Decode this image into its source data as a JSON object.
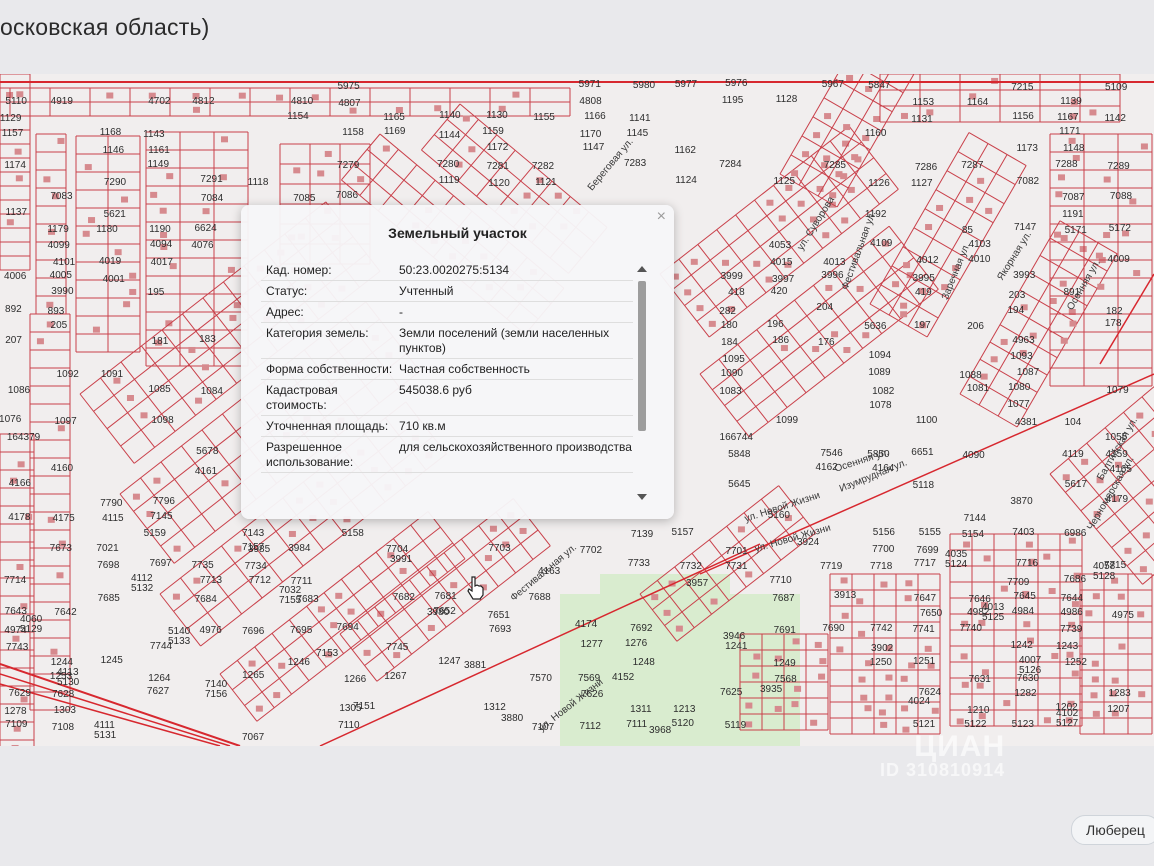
{
  "page": {
    "title": "осковская область)"
  },
  "map": {
    "parcel_labels": [
      "5975",
      "5971",
      "5980",
      "5977",
      "5976",
      "5967",
      "5847",
      "7215",
      "5109",
      "5110",
      "4919",
      "4702",
      "4812",
      "4810",
      "4807",
      "4808",
      "1195",
      "1128",
      "1153",
      "1164",
      "1139",
      "1129",
      "1154",
      "1165",
      "1140",
      "1130",
      "1155",
      "1166",
      "1141",
      "1131",
      "1156",
      "1167",
      "1142",
      "1157",
      "1168",
      "1143",
      "1158",
      "1169",
      "1144",
      "1159",
      "1170",
      "1145",
      "1160",
      "1171",
      "1146",
      "1161",
      "1172",
      "1147",
      "1162",
      "1173",
      "1148",
      "1174",
      "1149",
      "7279",
      "7280",
      "7281",
      "7282",
      "7283",
      "7284",
      "7285",
      "7286",
      "7287",
      "7288",
      "7289",
      "7290",
      "7291",
      "1118",
      "1119",
      "1120",
      "1121",
      "1124",
      "1125",
      "1126",
      "1127",
      "7082",
      "7083",
      "7084",
      "7085",
      "7086",
      "7087",
      "7088",
      "1137",
      "5621",
      "1192",
      "1191",
      "1179",
      "1180",
      "1190",
      "6624",
      "85",
      "7147",
      "5171",
      "5172",
      "4099",
      "4094",
      "4076",
      "4053",
      "4109",
      "4103",
      "4101",
      "4019",
      "4017",
      "4015",
      "4013",
      "4012",
      "4010",
      "4009",
      "4006",
      "4005",
      "4001",
      "3999",
      "3997",
      "3996",
      "3995",
      "3993",
      "3990",
      "195",
      "418",
      "420",
      "419",
      "203",
      "891",
      "892",
      "893",
      "282",
      "204",
      "194",
      "182",
      "205",
      "180",
      "196",
      "5636",
      "197",
      "206",
      "178",
      "207",
      "181",
      "183",
      "184",
      "186",
      "176",
      "4963",
      "1095",
      "1094",
      "1093",
      "1092",
      "1091",
      "1090",
      "1089",
      "1088",
      "1087",
      "1086",
      "1085",
      "1084",
      "1083",
      "1082",
      "1081",
      "1080",
      "1079",
      "1078",
      "1077",
      "1076",
      "1097",
      "1098",
      "1099",
      "1100",
      "4381",
      "104",
      "164379",
      "166744",
      "1055",
      "5678",
      "5848",
      "7546",
      "5850",
      "6651",
      "4090",
      "4119",
      "4159",
      "4160",
      "4161",
      "4162",
      "4164",
      "4165",
      "4166",
      "5645",
      "5118",
      "5617",
      "7790",
      "7796",
      "3870",
      "4179",
      "4178",
      "4175",
      "4115",
      "7145",
      "5160",
      "7144",
      "5159",
      "7143",
      "5158",
      "7139",
      "5157",
      "5156",
      "5155",
      "5154",
      "7403",
      "6986",
      "7673",
      "7021",
      "3985",
      "3984",
      "7704",
      "7703",
      "7702",
      "7701",
      "7700",
      "7699",
      "7698",
      "7697",
      "7735",
      "7734",
      "7733",
      "7732",
      "7731",
      "7719",
      "7718",
      "7717",
      "7716",
      "7715",
      "7714",
      "7713",
      "7712",
      "7711",
      "7710",
      "7709",
      "7686",
      "7685",
      "7684",
      "7683",
      "7682",
      "7681",
      "7688",
      "7687",
      "7647",
      "7646",
      "7645",
      "7644",
      "7643",
      "7642",
      "7652",
      "7651",
      "7650",
      "4982",
      "4984",
      "4986",
      "4975",
      "4974",
      "4976",
      "7696",
      "7695",
      "7694",
      "7693",
      "7692",
      "7691",
      "7690",
      "7742",
      "7741",
      "7740",
      "7739",
      "7743",
      "7744",
      "7745",
      "1277",
      "1276",
      "1241",
      "1242",
      "1243",
      "1244",
      "1245",
      "1246",
      "1247",
      "1248",
      "1249",
      "1250",
      "1251",
      "1252",
      "1253",
      "1264",
      "1265",
      "1266",
      "1267",
      "7570",
      "7569",
      "7568",
      "7631",
      "7630",
      "7629",
      "7628",
      "7627",
      "7626",
      "7625",
      "7624",
      "1282",
      "1283",
      "1278",
      "1303",
      "1305",
      "1312",
      "1311",
      "1213",
      "1210",
      "1202",
      "1207",
      "7109",
      "7108",
      "7110",
      "7107",
      "7112",
      "7111",
      "5120",
      "5119",
      "5121",
      "5122",
      "5123",
      "5124",
      "5125",
      "5126",
      "5127",
      "5128",
      "5129",
      "5130",
      "5131",
      "5132",
      "5133",
      "7156",
      "7157",
      "7155",
      "7153",
      "7151",
      "3991",
      "3980",
      "3881",
      "3880",
      "4163",
      "4174",
      "4152",
      "3968",
      "3957",
      "3946",
      "3935",
      "3924",
      "3913",
      "3902",
      "4024",
      "4035",
      "4013",
      "4007",
      "4102",
      "4058",
      "4060",
      "4113",
      "4111",
      "4112",
      "5140",
      "7140",
      "7067",
      "7032"
    ],
    "street_names": [
      "ул. Суворова",
      "Фестивальная ул.",
      "ул. Новой Жизни",
      "Заречная ул.",
      "Изумрудная ул.",
      "Осенняя ул.",
      "ул. Новой Жизни",
      "Фестивальная ул.",
      "ул. Новой Жизни",
      "Осенняя ул.",
      "Черноморская ул.",
      "Балтийская ул.",
      "Якорная ул.",
      "Береговая ул."
    ]
  },
  "popup": {
    "title": "Земельный участок",
    "close": "×",
    "rows": [
      {
        "label": "Кад. номер:",
        "value": "50:23.0020275:5134"
      },
      {
        "label": "Статус:",
        "value": "Учтенный"
      },
      {
        "label": "Адрес:",
        "value": "-"
      },
      {
        "label": "Категория земель:",
        "value": "Земли поселений (земли населенных пунктов)"
      },
      {
        "label": "Форма собственности:",
        "value": "Частная собственность"
      },
      {
        "label": "Кадастровая стоимость:",
        "value": "545038.6 руб"
      },
      {
        "label": "Уточненная площадь:",
        "value": "710 кв.м"
      },
      {
        "label": "Разрешенное использование:",
        "value": "для сельскохозяйственного производства"
      }
    ]
  },
  "watermark": {
    "brand": "ЦИАН",
    "id": "ID 310810914"
  },
  "tag": {
    "label": "Люберец"
  },
  "colors": {
    "parcel_line": "#c9404a",
    "road": "#d7282f",
    "building": "#d68a8e",
    "popup_bg": "#f6f6f8",
    "green": "#d9eccf"
  }
}
